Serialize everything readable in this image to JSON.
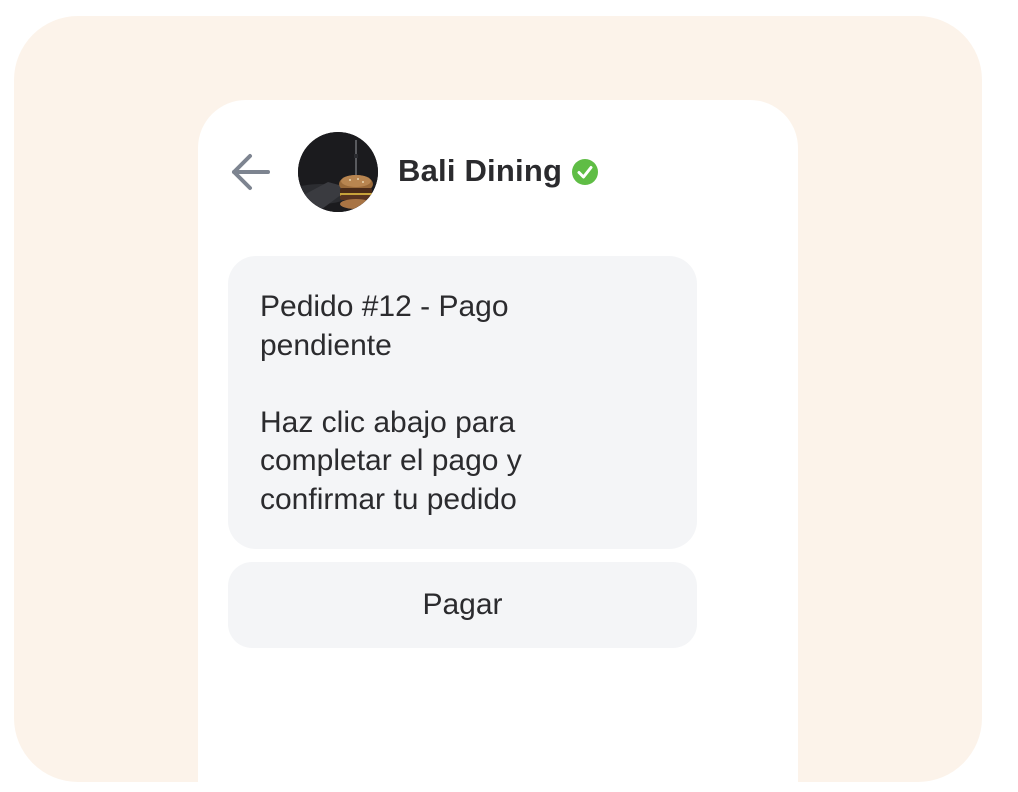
{
  "header": {
    "back_icon": "arrow-left-icon",
    "contact_name": "Bali Dining",
    "verified_icon": "verified-check-icon",
    "avatar_icon": "burger-photo-avatar"
  },
  "message": {
    "line1": "Pedido #12 - Pago",
    "line2": "pendiente",
    "line3": "Haz clic abajo para",
    "line4": "completar el pago y",
    "line5": "confirmar tu pedido"
  },
  "actions": {
    "pay_label": "Pagar"
  },
  "colors": {
    "outer_background": "#fcf3ea",
    "bubble_background": "#f4f5f7",
    "text": "#2b2b2e",
    "verified_green": "#5fbd45",
    "back_arrow": "#7d8490"
  }
}
